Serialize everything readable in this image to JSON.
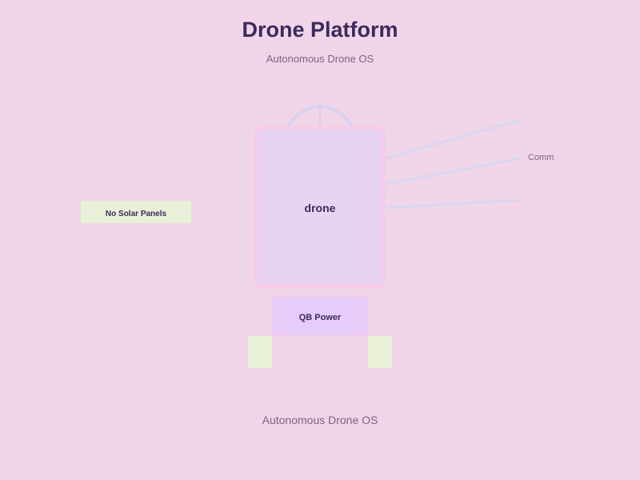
{
  "header": {
    "title": "Drone Platform",
    "subtitle": "Autonomous Drone OS"
  },
  "diagram": {
    "body_label": "drone",
    "power_label": "QB Power",
    "solar_label": "No Solar Panels",
    "comm_label": "Comm"
  },
  "footer": {
    "text": "Autonomous Drone OS"
  },
  "colors": {
    "background": "#f0d5e8",
    "title": "#3b2b5c",
    "body_fill": "#e8d3f5",
    "body_stroke": "#f9cbe6",
    "power_fill": "#e6ccf9",
    "foot_fill": "#e8f0d8",
    "antenna": "#d6d6f0"
  }
}
